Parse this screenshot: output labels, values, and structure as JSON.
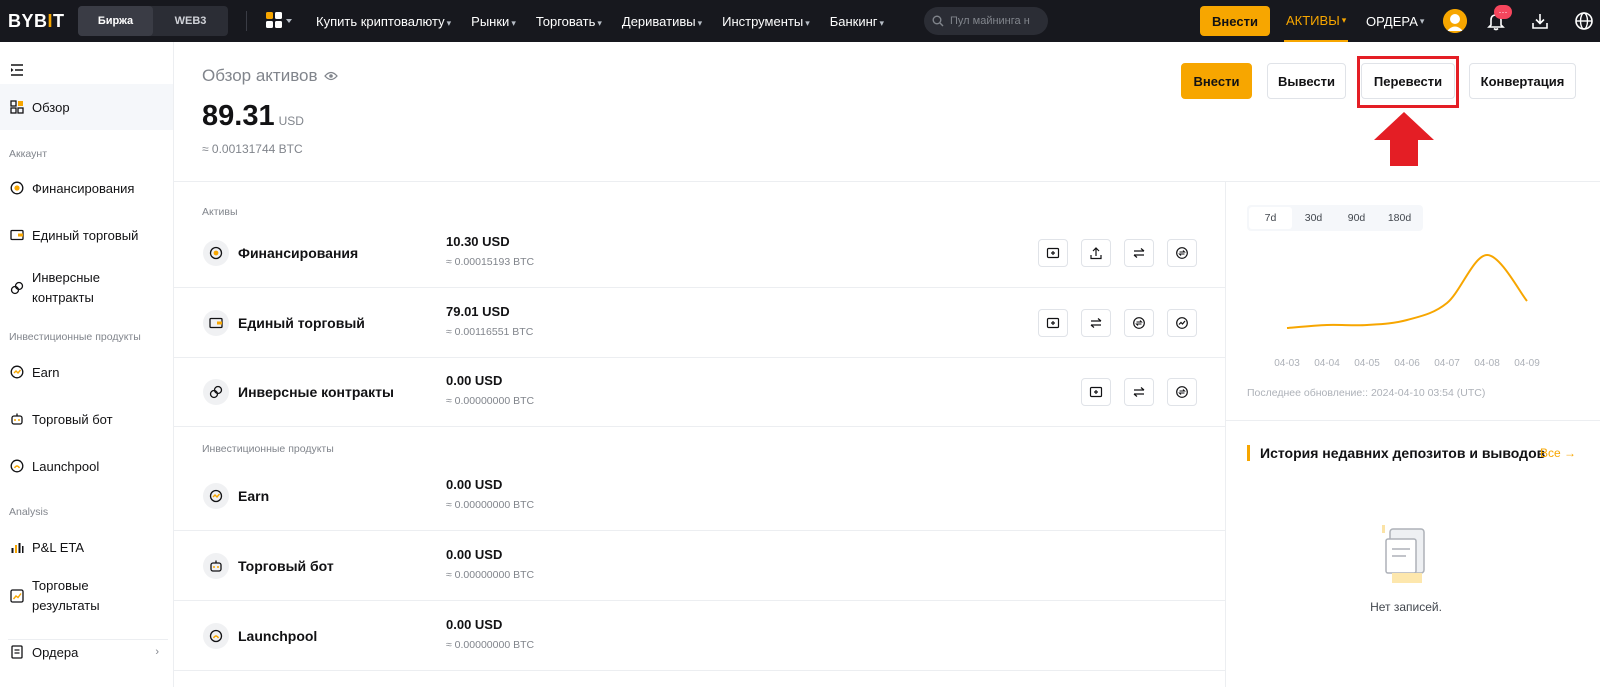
{
  "topbar": {
    "logo": {
      "text_a": "BYB",
      "text_bar": "I",
      "text_b": "T"
    },
    "segments": [
      "Биржа",
      "WEB3"
    ],
    "active_segment": "Биржа",
    "nav": [
      "Купить криптовалюту",
      "Рынки",
      "Торговать",
      "Деривативы",
      "Инструменты",
      "Банкинг"
    ],
    "search_placeholder": "Пул майнинга н",
    "deposit_label": "Внести",
    "assets_label": "АКТИВЫ",
    "orders_label": "ОРДЕРА",
    "notification_badge": "···",
    "accent": "#f7a600"
  },
  "sidebar": {
    "overview": "Обзор",
    "section_account": "Аккаунт",
    "funding": "Финансирования",
    "unified": "Единый торговый",
    "inverse_l1": "Инверсные",
    "inverse_l2": "контракты",
    "section_invest": "Инвестиционные продукты",
    "earn": "Earn",
    "bot": "Торговый бот",
    "launchpool": "Launchpool",
    "section_analysis": "Analysis",
    "pnl": "P&L ETA",
    "results_l1": "Торговые",
    "results_l2": "результаты",
    "orders": "Ордера"
  },
  "header": {
    "title": "Обзор активов",
    "balance": "89.31",
    "currency": "USD",
    "balance_btc": "≈ 0.00131744 BTC",
    "buttons": {
      "deposit": "Внести",
      "withdraw": "Вывести",
      "transfer": "Перевести",
      "convert": "Конвертация"
    }
  },
  "assets": {
    "section_assets": "Активы",
    "section_invest": "Инвестиционные продукты",
    "rows": [
      {
        "name": "Финансирования",
        "value": "10.30 USD",
        "btc": "≈ 0.00015193 BTC"
      },
      {
        "name": "Единый торговый",
        "value": "79.01 USD",
        "btc": "≈ 0.00116551 BTC"
      },
      {
        "name": "Инверсные контракты",
        "value": "0.00 USD",
        "btc": "≈ 0.00000000 BTC"
      },
      {
        "name": "Earn",
        "value": "0.00 USD",
        "btc": "≈ 0.00000000 BTC"
      },
      {
        "name": "Торговый бот",
        "value": "0.00 USD",
        "btc": "≈ 0.00000000 BTC"
      },
      {
        "name": "Launchpool",
        "value": "0.00 USD",
        "btc": "≈ 0.00000000 BTC"
      }
    ]
  },
  "chart_panel": {
    "ranges": [
      "7d",
      "30d",
      "90d",
      "180d"
    ],
    "active_range": "7d",
    "updated": "Последнее обновление:: 2024-04-10 03:54 (UTC)",
    "line_color": "#f7a600"
  },
  "chart_data": {
    "type": "line",
    "categories": [
      "04-03",
      "04-04",
      "04-05",
      "04-06",
      "04-07",
      "04-08",
      "04-09"
    ],
    "values": [
      0.2,
      0.23,
      0.23,
      0.28,
      0.45,
      0.93,
      0.47
    ],
    "ylim": [
      0,
      1
    ],
    "grid": false
  },
  "history": {
    "title": "История недавних депозитов и выводов",
    "all_label": "Все →",
    "empty": "Нет записей."
  }
}
